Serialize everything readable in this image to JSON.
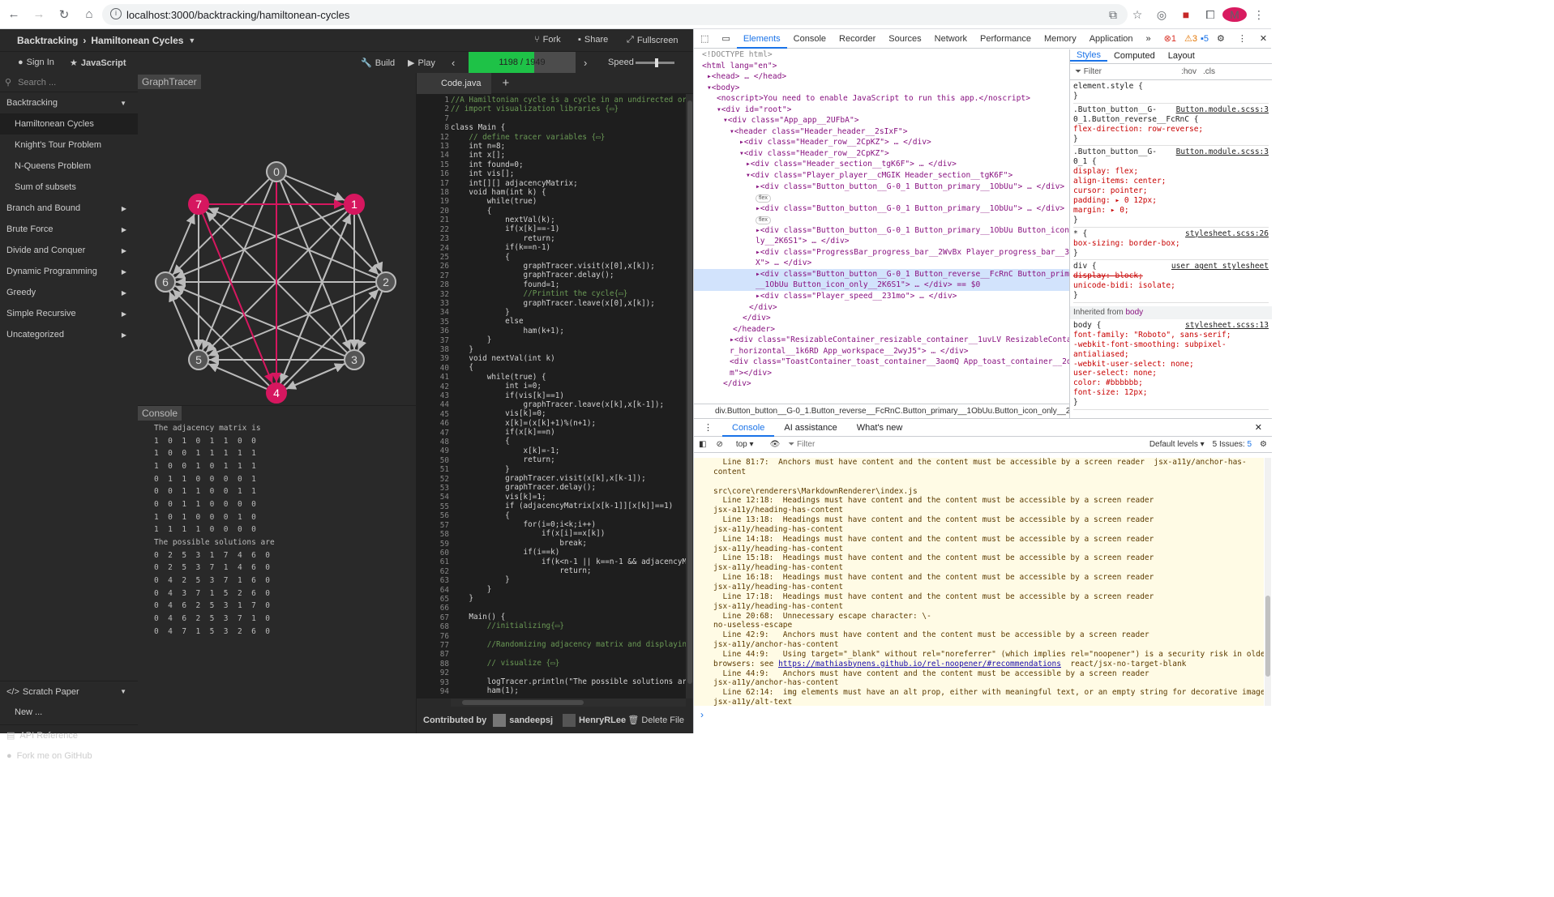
{
  "browser": {
    "url": "localhost:3000/backtracking/hamiltonean-cycles",
    "avatar_letter": "M"
  },
  "app": {
    "breadcrumb_category": "Backtracking",
    "breadcrumb_sep": "›",
    "breadcrumb_algo": "Hamiltonean Cycles",
    "fork": "Fork",
    "share": "Share",
    "fullscreen": "Fullscreen",
    "sign_in": "Sign In",
    "language": "JavaScript",
    "build": "Build",
    "play": "Play",
    "progress_text": "1198 / 1949",
    "progress_fraction": 0.615,
    "speed": "Speed",
    "speed_level": 0.55,
    "search_placeholder": "Search ...",
    "menu": [
      {
        "label": "Backtracking",
        "open": true,
        "items": [
          "Hamiltonean Cycles",
          "Knight's Tour Problem",
          "N-Queens Problem",
          "Sum of subsets"
        ]
      },
      {
        "label": "Branch and Bound"
      },
      {
        "label": "Brute Force"
      },
      {
        "label": "Divide and Conquer"
      },
      {
        "label": "Dynamic Programming"
      },
      {
        "label": "Greedy"
      },
      {
        "label": "Simple Recursive"
      },
      {
        "label": "Uncategorized"
      }
    ],
    "scratch": "Scratch Paper",
    "new": "New ...",
    "api": "API Reference",
    "github": "Fork me on GitHub",
    "graph_tab": "GraphTracer",
    "console_tab": "Console",
    "console_lines": [
      "The adjacency matrix is",
      "1  0  1  0  1  1  0  0",
      "1  0  0  1  1  1  1  1",
      "1  0  0  1  0  1  1  1",
      "0  1  1  0  0  0  0  1",
      "0  0  1  1  0  0  1  1",
      "0  0  1  1  0  0  0  0",
      "1  0  1  0  0  0  1  0",
      "1  1  1  1  0  0  0  0",
      "The possible solutions are",
      "0  2  5  3  1  7  4  6  0",
      "0  2  5  3  7  1  4  6  0",
      "0  4  2  5  3  7  1  6  0",
      "0  4  3  7  1  5  2  6  0",
      "0  4  6  2  5  3  1  7  0",
      "0  4  6  2  5  3  7  1  0",
      "0  4  7  1  5  3  2  6  0"
    ],
    "code_tab": "Code.java",
    "contributed_by": "Contributed by",
    "contributors": [
      "sandeepsj",
      "HenryRLee"
    ],
    "delete_file": "Delete File",
    "nodes": [
      "0",
      "1",
      "2",
      "3",
      "4",
      "5",
      "6",
      "7"
    ],
    "highlight_color": "#d6175f",
    "code_line_numbers": [
      "1",
      "2",
      "7",
      "8",
      "12",
      "13",
      "14",
      "15",
      "16",
      "17",
      "18",
      "19",
      "20",
      "21",
      "22",
      "23",
      "24",
      "25",
      "26",
      "27",
      "28",
      "32",
      "33",
      "34",
      "35",
      "36",
      "37",
      "38",
      "39",
      "40",
      "41",
      "42",
      "43",
      "44",
      "45",
      "46",
      "47",
      "48",
      "49",
      "50",
      "51",
      "52",
      "53",
      "54",
      "55",
      "56",
      "57",
      "58",
      "59",
      "60",
      "61",
      "62",
      "63",
      "64",
      "65",
      "66",
      "67",
      "68",
      "76",
      "77",
      "87",
      "88",
      "92",
      "93",
      "94"
    ],
    "code_lines": [
      "//A Hamiltonian cycle is a cycle in an undirected or",
      "// import visualization libraries {▭}",
      "",
      "class Main {",
      "    // define tracer variables {▭}",
      "    int n=8;",
      "    int x[];",
      "    int found=0;",
      "    int vis[];",
      "    int[][] adjacencyMatrix;",
      "    void ham(int k) {",
      "        while(true)",
      "        {",
      "            nextVal(k);",
      "            if(x[k]==-1)",
      "                return;",
      "            if(k==n-1)",
      "            {",
      "                graphTracer.visit(x[0],x[k]);",
      "                graphTracer.delay();",
      "                found=1;",
      "                //Printint the cycle{▭}",
      "                graphTracer.leave(x[0],x[k]);",
      "            }",
      "            else",
      "                ham(k+1);",
      "        }",
      "    }",
      "    void nextVal(int k)",
      "    {",
      "        while(true) {",
      "            int i=0;",
      "            if(vis[k]==1)",
      "                graphTracer.leave(x[k],x[k-1]);",
      "            vis[k]=0;",
      "            x[k]=(x[k]+1)%(n+1);",
      "            if(x[k]==n)",
      "            {",
      "                x[k]=-1;",
      "                return;",
      "            }",
      "            graphTracer.visit(x[k],x[k-1]);",
      "            graphTracer.delay();",
      "            vis[k]=1;",
      "            if (adjacencyMatrix[x[k-1]][x[k]]==1)",
      "            {",
      "                for(i=0;i<k;i++)",
      "                    if(x[i]==x[k])",
      "                        break;",
      "                if(i==k)",
      "                    if(k<n-1 || k==n-1 && adjacencyMat",
      "                        return;",
      "            }",
      "        }",
      "    }",
      "",
      "    Main() {",
      "        //initializing{▭}",
      "",
      "        //Randomizing adjacency matrix and displaying",
      "",
      "        // visualize {▭}",
      "",
      "        logTracer.println(\"The possible solutions are\"",
      "        ham(1);"
    ]
  },
  "devtools": {
    "tabs": [
      "Elements",
      "Console",
      "Recorder",
      "Sources",
      "Network",
      "Performance",
      "Memory",
      "Application"
    ],
    "errors": "1",
    "warnings": "3",
    "infos": "5",
    "styles_tabs": [
      "Styles",
      "Computed",
      "Layout"
    ],
    "filter_placeholder": "Filter",
    "hov": ":hov",
    "cls": ".cls",
    "breadcrumb": "div.Button_button__G-0_1.Button_reverse__FcRnC.Button_primary__1ObUu.Button_icon_only__2K6S1",
    "drawer_tabs": [
      "Console",
      "AI assistance",
      "What's new"
    ],
    "context": "top",
    "levels": "Default levels",
    "issues": "5 Issues:",
    "issues_count": "5",
    "inherited": "Inherited from",
    "inherited_el": "body",
    "dom_lines": [
      "<!DOCTYPE html>",
      "<html lang=\"en\">",
      "▸<head> … </head>",
      "▾<body>",
      "<noscript>You need to enable JavaScript to run this app.</noscript>",
      "▾<div id=\"root\">",
      "▾<div class=\"App_app__2UFbA\">",
      "▾<header class=\"Header_header__2sIxF\">",
      "▸<div class=\"Header_row__2CpKZ\"> … </div>",
      "▾<div class=\"Header_row__2CpKZ\">",
      "▸<div class=\"Header_section__tgK6F\"> … </div>",
      "▾<div class=\"Player_player__cMGIK Header_section__tgK6F\">",
      "▸<div class=\"Button_button__G-0_1 Button_primary__1ObUu\"> … </div>",
      "",
      "▸<div class=\"Button_button__G-0_1 Button_primary__1ObUu\"> … </div>",
      "",
      "▸<div class=\"Button_button__G-0_1 Button_primary__1ObUu Button_icon_on",
      "ly__2K6S1\"> … </div>",
      "▸<div class=\"ProgressBar_progress_bar__2WvBx Player_progress_bar__33Pk",
      "X\"> … </div>",
      "▸<div class=\"Button_button__G-0_1 Button_reverse__FcRnC Button_primary",
      "__1ObUu Button_icon_only__2K6S1\"> … </div> == $0",
      "▸<div class=\"Player_speed__231mo\"> … </div>",
      "</div>",
      "</div>",
      "</header>",
      "▸<div class=\"ResizableContainer_resizable_container__1uvLV ResizableContaine",
      "r_horizontal__1k6RD App_workspace__2wyJ5\"> … </div>",
      "<div class=\"ToastContainer_toast_container__3aomQ App_toast_container__2qB1",
      "m\"></div>",
      "</div>"
    ],
    "style_rules": [
      "element.style {",
      "}",
      ".Button_button__G-|Button.module.scss:3",
      "0_1.Button_reverse__FcRnC {",
      "  flex-direction: row-reverse;",
      "}",
      ".Button_button__G-|Button.module.scss:3",
      "0_1 {",
      "  display: flex;",
      "  align-items: center;",
      "  cursor: pointer;",
      "  padding: ▸ 0 12px;",
      "  margin: ▸ 0;",
      "}",
      "* {|stylesheet.scss:26",
      "  box-sizing: border-box;",
      "}",
      "div {|user agent stylesheet",
      "  display: block;",
      "  unicode-bidi: isolate;",
      "}"
    ],
    "body_rules": [
      "body {|stylesheet.scss:13",
      "  font-family: \"Roboto\", sans-serif;",
      "  -webkit-font-smoothing: subpixel-",
      "      antialiased;",
      "  -webkit-user-select: none;",
      "  user-select: none;",
      "  color: #bbbbbb;",
      "  font-size: 12px;",
      "}"
    ],
    "console_lines": [
      "  Line 81:7:  Anchors must have content and the content must be accessible by a screen reader  jsx-a11y/anchor-has-",
      "content",
      "",
      "src\\core\\renderers\\MarkdownRenderer\\index.js",
      "  Line 12:18:  Headings must have content and the content must be accessible by a screen reader",
      "jsx-a11y/heading-has-content",
      "  Line 13:18:  Headings must have content and the content must be accessible by a screen reader",
      "jsx-a11y/heading-has-content",
      "  Line 14:18:  Headings must have content and the content must be accessible by a screen reader",
      "jsx-a11y/heading-has-content",
      "  Line 15:18:  Headings must have content and the content must be accessible by a screen reader",
      "jsx-a11y/heading-has-content",
      "  Line 16:18:  Headings must have content and the content must be accessible by a screen reader",
      "jsx-a11y/heading-has-content",
      "  Line 17:18:  Headings must have content and the content must be accessible by a screen reader",
      "jsx-a11y/heading-has-content",
      "  Line 20:68:  Unnecessary escape character: \\-",
      "no-useless-escape",
      "  Line 42:9:   Anchors must have content and the content must be accessible by a screen reader",
      "jsx-a11y/anchor-has-content",
      "  Line 44:9:   Using target=\"_blank\" without rel=\"noreferrer\" (which implies rel=\"noopener\") is a security risk in older",
      "browsers: see |https://mathiasbynens.github.io/rel-noopener/#recommendations|  react/jsx-no-target-blank",
      "  Line 44:9:   Anchors must have content and the content must be accessible by a screen reader",
      "jsx-a11y/anchor-has-content",
      "  Line 62:14:  img elements must have an alt prop, either with meaningful text, or an empty string for decorative images",
      "jsx-a11y/alt-text"
    ]
  }
}
